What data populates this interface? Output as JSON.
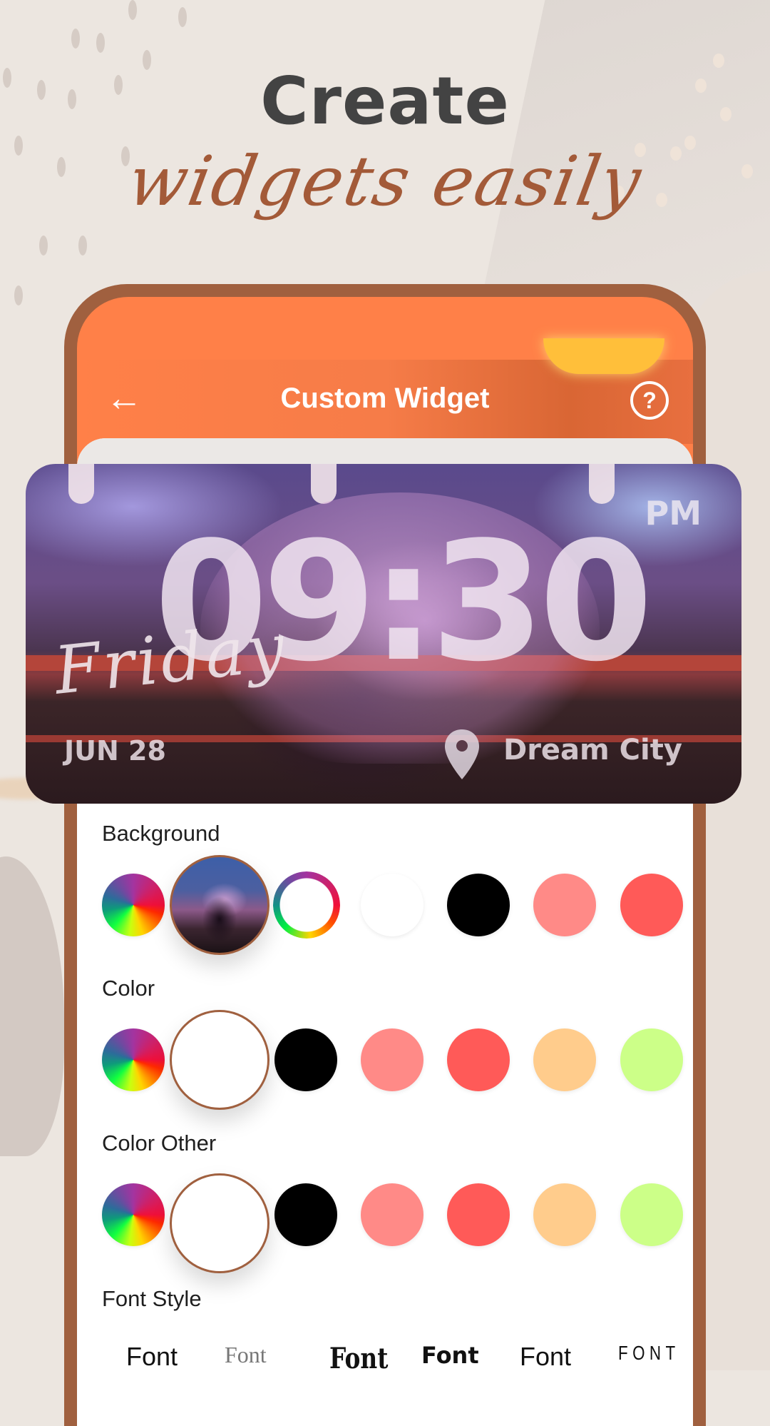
{
  "hero": {
    "title": "Create",
    "subtitle": "widgets easily"
  },
  "appbar": {
    "title": "Custom Widget",
    "back_icon": "←",
    "help_icon": "?"
  },
  "widget_preview": {
    "time": "09:30",
    "ampm": "PM",
    "day": "Friday",
    "date": "JUN 28",
    "location": "Dream City"
  },
  "sections": {
    "background": {
      "label": "Background",
      "options": [
        {
          "type": "color-picker",
          "name": "rainbow-picker"
        },
        {
          "type": "photo",
          "name": "photo-background",
          "selected": true
        },
        {
          "type": "gradient-ring",
          "name": "gradient-ring"
        },
        {
          "type": "color",
          "color": "#ffffff"
        },
        {
          "type": "color",
          "color": "#000000"
        },
        {
          "type": "color",
          "color": "#ff8a87"
        },
        {
          "type": "color",
          "color": "#ff5a58"
        }
      ]
    },
    "color": {
      "label": "Color",
      "options": [
        {
          "type": "color-picker",
          "name": "rainbow-picker"
        },
        {
          "type": "color",
          "color": "#ffffff",
          "selected": true
        },
        {
          "type": "color",
          "color": "#000000"
        },
        {
          "type": "color",
          "color": "#ff8a87"
        },
        {
          "type": "color",
          "color": "#ff5a58"
        },
        {
          "type": "color",
          "color": "#ffcc8c"
        },
        {
          "type": "color",
          "color": "#ccff88"
        }
      ]
    },
    "color_other": {
      "label": "Color Other",
      "options": [
        {
          "type": "color-picker",
          "name": "rainbow-picker"
        },
        {
          "type": "color",
          "color": "#ffffff",
          "selected": true
        },
        {
          "type": "color",
          "color": "#000000"
        },
        {
          "type": "color",
          "color": "#ff8a87"
        },
        {
          "type": "color",
          "color": "#ff5a58"
        },
        {
          "type": "color",
          "color": "#ffcc8c"
        },
        {
          "type": "color",
          "color": "#ccff88"
        }
      ]
    },
    "font_style": {
      "label": "Font Style",
      "options": [
        "Font",
        "Font",
        "Font",
        "Font",
        "Font",
        "FONT"
      ]
    }
  },
  "colors": {
    "accent": "#ff8048",
    "frame": "#a0603f",
    "hero_title": "#434343",
    "hero_subtitle": "#a35a38"
  }
}
